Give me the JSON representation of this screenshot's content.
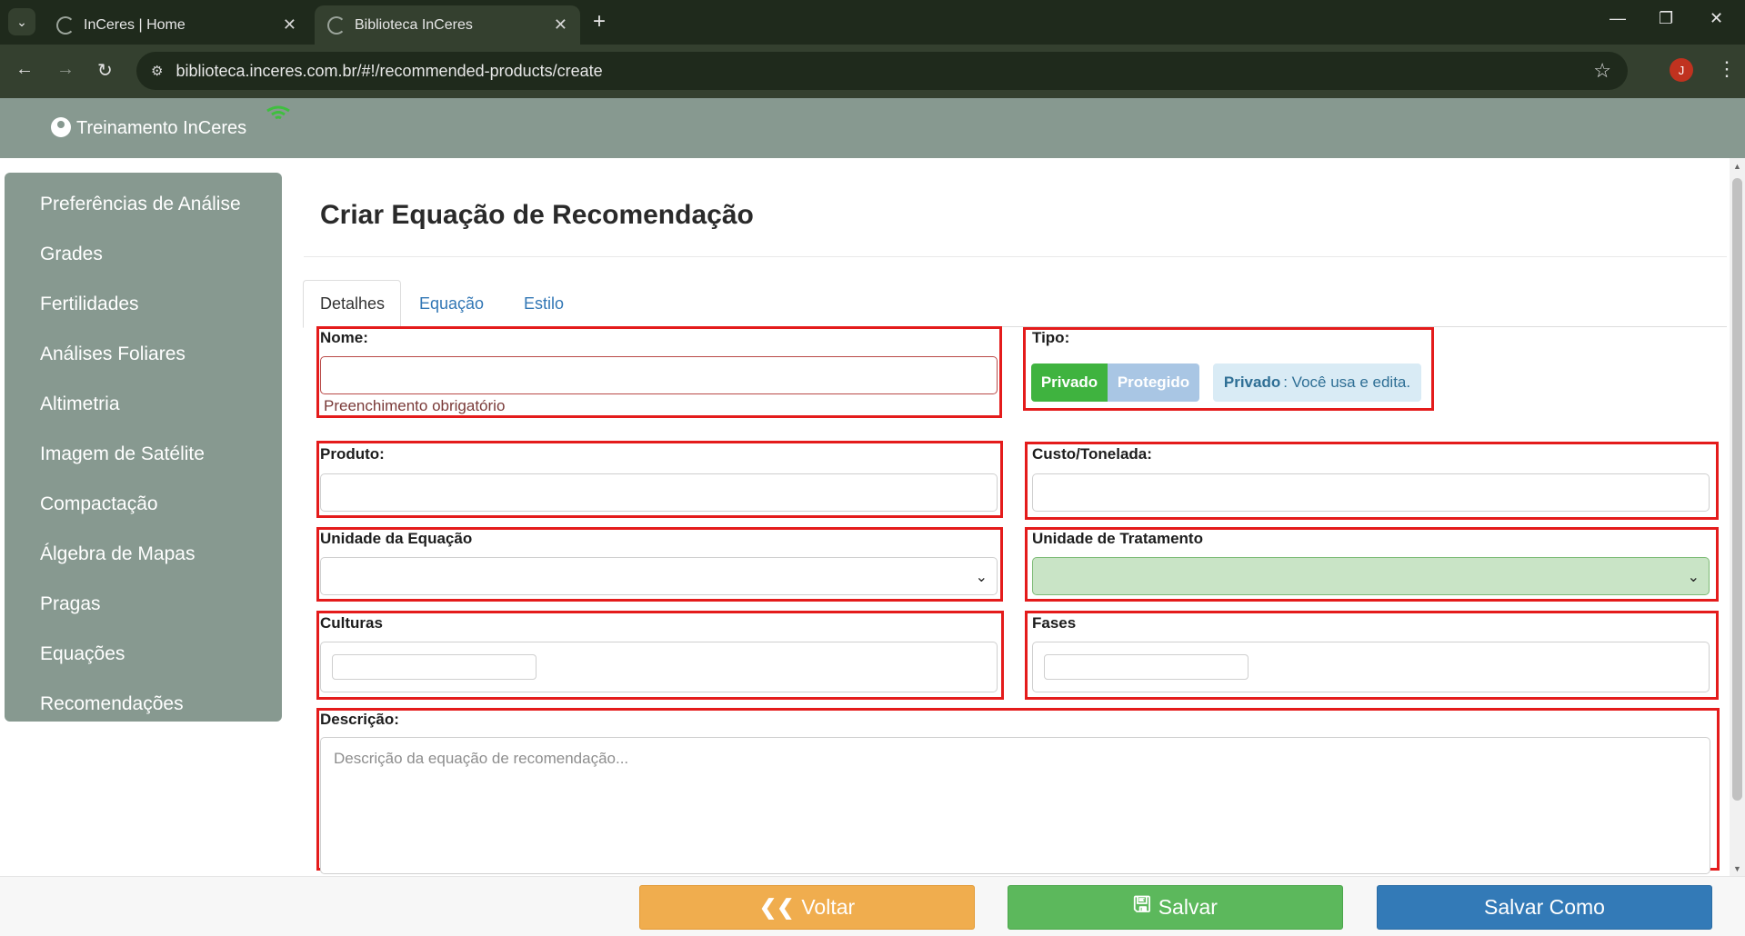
{
  "browser": {
    "tabs": [
      {
        "title": "InCeres | Home"
      },
      {
        "title": "Biblioteca InCeres"
      }
    ],
    "url": "biblioteca.inceres.com.br/#!/recommended-products/create",
    "profile_initial": "J"
  },
  "header": {
    "user_name": "Treinamento InCeres"
  },
  "sidebar": {
    "items": [
      {
        "label": "Preferências de Análise"
      },
      {
        "label": "Grades"
      },
      {
        "label": "Fertilidades"
      },
      {
        "label": "Análises Foliares"
      },
      {
        "label": "Altimetria"
      },
      {
        "label": "Imagem de Satélite"
      },
      {
        "label": "Compactação"
      },
      {
        "label": "Álgebra de Mapas"
      },
      {
        "label": "Pragas"
      },
      {
        "label": "Equações"
      },
      {
        "label": "Recomendações"
      }
    ]
  },
  "main": {
    "title": "Criar Equação de Recomendação",
    "tabs": [
      {
        "label": "Detalhes"
      },
      {
        "label": "Equação"
      },
      {
        "label": "Estilo"
      }
    ],
    "form": {
      "nome_label": "Nome:",
      "nome_value": "",
      "nome_help": "Preenchimento obrigatório",
      "tipo_label": "Tipo:",
      "tipo_options": [
        "Privado",
        "Protegido"
      ],
      "tipo_selected": "Privado",
      "tipo_note_bold": "Privado",
      "tipo_note_text": ": Você usa e edita.",
      "produto_label": "Produto:",
      "produto_value": "",
      "custo_label": "Custo/Tonelada:",
      "custo_value": "",
      "unidade_equacao_label": "Unidade da Equação",
      "unidade_equacao_value": "",
      "unidade_tratamento_label": "Unidade de Tratamento",
      "unidade_tratamento_value": "",
      "culturas_label": "Culturas",
      "fases_label": "Fases",
      "descricao_label": "Descrição:",
      "descricao_placeholder": "Descrição da equação de recomendação..."
    }
  },
  "footer": {
    "voltar_label": "Voltar",
    "salvar_label": "Salvar",
    "salvar_como_label": "Salvar Como"
  },
  "colors": {
    "header_bg": "#879990",
    "highlight_border": "#e41b1b",
    "privado_green": "#3fb33f",
    "voltar_orange": "#f0ad4e",
    "salvar_green": "#5cb85c",
    "salvar_como_blue": "#337ab7"
  }
}
